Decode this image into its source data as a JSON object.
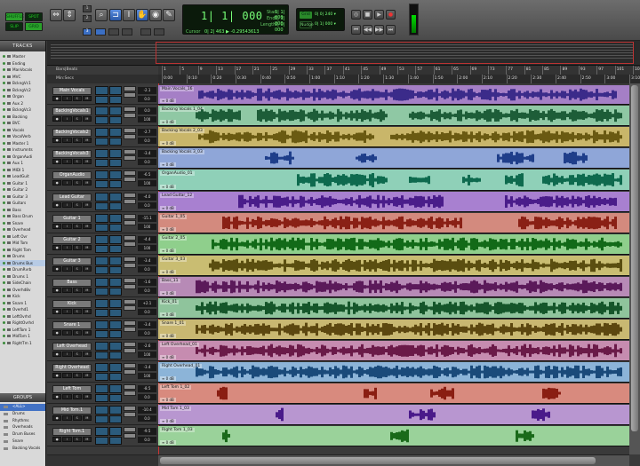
{
  "modes": {
    "shuffle": "SHUFFLE",
    "spot": "SPOT",
    "slip": "SLIP",
    "grid": "GRID"
  },
  "counter": {
    "main": "1| 1| 000",
    "arrow": "▾",
    "cursor_label": "Cursor",
    "cursor_val": "0| 2| 463 ▶ -0.29543613",
    "start_label": "Start",
    "start_val": "1| 1| 000",
    "end_label": "End",
    "end_val": "1| 1| 000",
    "length_label": "Length",
    "length_val": "0| 0| 000"
  },
  "grid": {
    "grid_label": "Grid",
    "grid_val": "0| 0| 240 ▾",
    "nudge_label": "Nudge",
    "nudge_val": "0| 1| 000 ▾"
  },
  "panels": {
    "tracks_title": "TRACKS",
    "groups_title": "GROUPS"
  },
  "track_list": [
    "Master",
    "Ending",
    "ManVocals",
    "MVC",
    "BckngVc1",
    "BckngVc2",
    "Organ",
    "Aux 2",
    "BckngVc3",
    "Backing",
    "BVC",
    "Vocals",
    "VocalVerb",
    "Master 1",
    "Instrumnts",
    "OrganAudi",
    "Aux 1",
    "MIDI 1",
    "LeadGuit",
    "Guitar 1",
    "Guitar 2",
    "Guitar 3",
    "Guitars",
    "Bass",
    "Bass Drum",
    "Snare",
    "Overhead",
    "Left Ovr",
    "Mid Tom",
    "Right Tom",
    "Drums",
    "Drums Bus",
    "DrumRvrb",
    "Drums 1",
    "SideChain",
    "Overhd8v",
    "Kick",
    "Snare 1",
    "Overhd1",
    "LeftOvrhd",
    "RightOvrhd",
    "LeftTom 1",
    "MidTom 1",
    "RightTm 1"
  ],
  "group_list": [
    "<ALL>",
    "Drums",
    "Rhythms",
    "Overheads",
    "Drum Buses",
    "Snare",
    "Backing Vocals"
  ],
  "rulers": {
    "bars_label": "Bars|Beats",
    "mins_label": "Min:Secs",
    "bars": [
      "1",
      "5",
      "9",
      "13",
      "17",
      "21",
      "25",
      "29",
      "33",
      "37",
      "41",
      "45",
      "49",
      "53",
      "57",
      "61",
      "65",
      "69",
      "73",
      "77",
      "81",
      "85",
      "89",
      "93",
      "97",
      "101",
      "105"
    ],
    "mins": [
      "0:00",
      "0:10",
      "0:20",
      "0:30",
      "0:40",
      "0:50",
      "1:00",
      "1:10",
      "1:20",
      "1:30",
      "1:40",
      "1:50",
      "2:00",
      "2:10",
      "2:20",
      "2:30",
      "2:40",
      "2:50",
      "3:00",
      "3:10"
    ]
  },
  "tracks": [
    {
      "name": "Main Vocals",
      "clip": "Main Vocals_16",
      "color": "#a57fc6",
      "wave": "#3b2b8a",
      "vol": "-2.1",
      "pan": "0.0"
    },
    {
      "name": "BackingVocals1",
      "clip": "Backing Vocals 1_04",
      "color": "#8fc8a4",
      "wave": "#1d5d38",
      "vol": "0.0",
      "pan": "100"
    },
    {
      "name": "BackingVocals2",
      "clip": "Backing Vocals 2_03",
      "color": "#c9b66a",
      "wave": "#6a5a12",
      "vol": "-2.7",
      "pan": "0.0"
    },
    {
      "name": "BackingVocals3",
      "clip": "Backing Vocals 3_03",
      "color": "#8fa6d8",
      "wave": "#1f3e8a",
      "vol": "-3.4",
      "pan": "0.0"
    },
    {
      "name": "OrganAudio",
      "clip": "OrganAudio_01",
      "color": "#8fd0b8",
      "wave": "#0e6a4e",
      "vol": "-6.5",
      "pan": "100"
    },
    {
      "name": "Lead Guitar",
      "clip": "Lead Guitar_12",
      "color": "#a880d0",
      "wave": "#4a1d8a",
      "vol": "-4.0",
      "pan": "0.0"
    },
    {
      "name": "Guitar 1",
      "clip": "Guitar 1_05",
      "color": "#d38a7e",
      "wave": "#8a2015",
      "vol": "-15.1",
      "pan": "100"
    },
    {
      "name": "Guitar 2",
      "clip": "Guitar 2_05",
      "color": "#8fcf8c",
      "wave": "#126a18",
      "vol": "-4.4",
      "pan": "100"
    },
    {
      "name": "Guitar 3",
      "clip": "Guitar 3_03",
      "color": "#c9bd72",
      "wave": "#5a4e10",
      "vol": "-3.4",
      "pan": "0.0"
    },
    {
      "name": "Bass",
      "clip": "Bass_11",
      "color": "#b78ab6",
      "wave": "#5b1a5a",
      "vol": "-1.6",
      "pan": "0.0"
    },
    {
      "name": "Kick",
      "clip": "Kick_01",
      "color": "#8fc49c",
      "wave": "#15562a",
      "vol": "+2.1",
      "pan": "0.0"
    },
    {
      "name": "Snare 1",
      "clip": "Snare 1_01",
      "color": "#c9b872",
      "wave": "#5c4710",
      "vol": "-3.4",
      "pan": "0.0"
    },
    {
      "name": "Left Overhead",
      "clip": "Left Overhead_01",
      "color": "#c68cb0",
      "wave": "#6a1a48",
      "vol": "-2.6",
      "pan": "100"
    },
    {
      "name": "Right Overhead",
      "clip": "Right Overhead_01",
      "color": "#8cb4d8",
      "wave": "#1a4a7a",
      "vol": "-3.4",
      "pan": "100"
    },
    {
      "name": "Left Tom",
      "clip": "Left Tom 1_02",
      "color": "#d88a7e",
      "wave": "#8a1e12",
      "vol": "-8.5",
      "pan": "0.0"
    },
    {
      "name": "Mid Tom.1",
      "clip": "Mid Tom 1_03",
      "color": "#b896d0",
      "wave": "#4a1a8a",
      "vol": "-10.4",
      "pan": "0.0"
    },
    {
      "name": "Right Tom.1",
      "clip": "Right Tom 1_03",
      "color": "#9ad29a",
      "wave": "#1a6a1a",
      "vol": "-9.5",
      "pan": "0.0"
    }
  ],
  "inserts_header": "INSERTS A-E",
  "io_header": "I / O"
}
